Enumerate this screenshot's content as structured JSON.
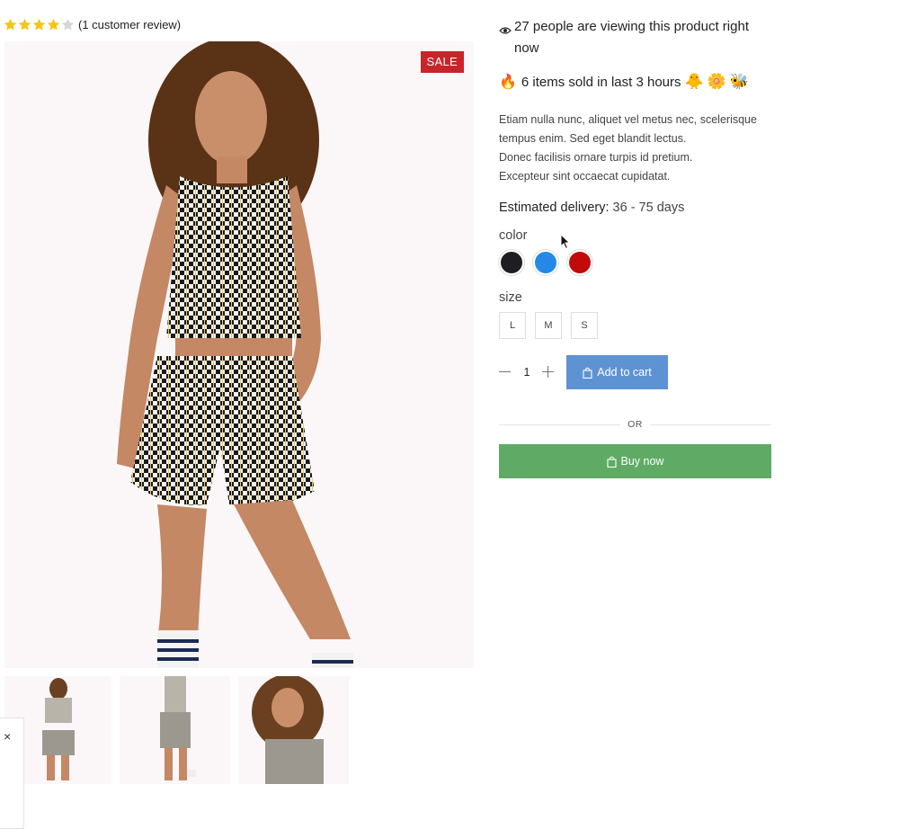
{
  "rating": {
    "stars_filled": 4,
    "stars_total": 5,
    "review_text": "(1 customer review)",
    "star_color": "#f5c518",
    "star_empty_color": "#d6d6d6"
  },
  "gallery": {
    "sale_badge": "SALE",
    "badge_color": "#c8252b"
  },
  "close_label": "×",
  "product": {
    "viewing_text": "27 people are viewing this product right now",
    "sold_text": "6 items sold in last 3 hours",
    "sold_emojis": [
      "🐥",
      "🌼",
      "🐝"
    ],
    "fire_emoji": "🔥",
    "description_lines": [
      "Etiam nulla nunc, aliquet vel metus nec, scelerisque tempus enim. Sed eget blandit lectus.",
      "Donec facilisis ornare turpis id pretium.",
      "Excepteur sint occaecat cupidatat."
    ],
    "delivery_label": "Estimated delivery:",
    "delivery_value": "36 - 75 days",
    "color_label": "color",
    "colors": [
      "#1e1e22",
      "#2489e6",
      "#c10a0a"
    ],
    "size_label": "size",
    "sizes": [
      "L",
      "M",
      "S"
    ],
    "quantity": "1",
    "add_to_cart": "Add to cart",
    "add_to_cart_color": "#5d93d2",
    "or_text": "OR",
    "buy_now": "Buy now",
    "buy_now_color": "#5fab65"
  }
}
